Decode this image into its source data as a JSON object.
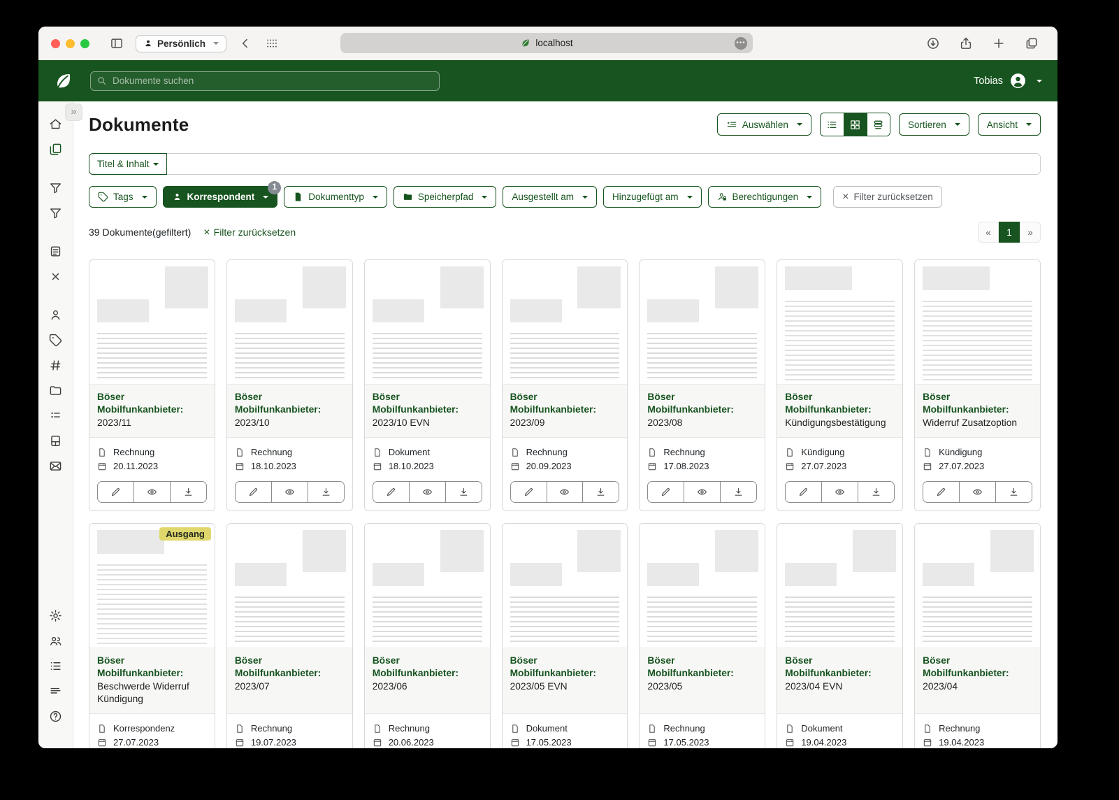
{
  "browser": {
    "profile_label": "Persönlich",
    "url_host": "localhost"
  },
  "app_header": {
    "search_placeholder": "Dokumente suchen",
    "user_name": "Tobias"
  },
  "sidebar_icons": [
    "home",
    "documents",
    "filter",
    "filter-alt",
    "notes",
    "close",
    "correspondents",
    "tags",
    "hash",
    "storage-paths",
    "custom-fields",
    "document-types",
    "mail",
    "settings",
    "users-groups",
    "tasks",
    "logs",
    "help"
  ],
  "page": {
    "title": "Dokumente",
    "select_label": "Auswählen",
    "sort_label": "Sortieren",
    "view_label": "Ansicht"
  },
  "search_bar": {
    "field_label": "Titel & Inhalt",
    "value": ""
  },
  "filters": {
    "tags_label": "Tags",
    "correspondent_label": "Korrespondent",
    "correspondent_count": "1",
    "document_type_label": "Dokumenttyp",
    "storage_path_label": "Speicherpfad",
    "created_label": "Ausgestellt am",
    "added_label": "Hinzugefügt am",
    "permissions_label": "Berechtigungen",
    "reset_label": "Filter zurücksetzen"
  },
  "results": {
    "count_text": "39 Dokumente(gefiltert)",
    "reset_label": "Filter zurücksetzen",
    "page_number": "1"
  },
  "documents": {
    "cards": [
      {
        "title_prefix": "Böser Mobilfunkanbieter:",
        "title_suffix": "2023/11",
        "doc_type": "Rechnung",
        "date": "20.11.2023",
        "thumb": "invoice"
      },
      {
        "title_prefix": "Böser Mobilfunkanbieter:",
        "title_suffix": "2023/10",
        "doc_type": "Rechnung",
        "date": "18.10.2023",
        "thumb": "invoice"
      },
      {
        "title_prefix": "Böser Mobilfunkanbieter:",
        "title_suffix": "2023/10 EVN",
        "doc_type": "Dokument",
        "date": "18.10.2023",
        "thumb": "invoice"
      },
      {
        "title_prefix": "Böser Mobilfunkanbieter:",
        "title_suffix": "2023/09",
        "doc_type": "Rechnung",
        "date": "20.09.2023",
        "thumb": "invoice"
      },
      {
        "title_prefix": "Böser Mobilfunkanbieter:",
        "title_suffix": "2023/08",
        "doc_type": "Rechnung",
        "date": "17.08.2023",
        "thumb": "invoice"
      },
      {
        "title_prefix": "Böser Mobilfunkanbieter:",
        "title_suffix": "Kündigungsbestätigung",
        "doc_type": "Kündigung",
        "date": "27.07.2023",
        "thumb": "letter"
      },
      {
        "title_prefix": "Böser Mobilfunkanbieter:",
        "title_suffix": "Widerruf Zusatzoption",
        "doc_type": "Kündigung",
        "date": "27.07.2023",
        "thumb": "letter"
      },
      {
        "title_prefix": "Böser Mobilfunkanbieter:",
        "title_suffix": "Beschwerde Widerruf Kündigung",
        "doc_type": "Korrespondenz",
        "date": "27.07.2023",
        "thumb": "letter",
        "badge": "Ausgang"
      },
      {
        "title_prefix": "Böser Mobilfunkanbieter:",
        "title_suffix": "2023/07",
        "doc_type": "Rechnung",
        "date": "19.07.2023",
        "thumb": "invoice"
      },
      {
        "title_prefix": "Böser Mobilfunkanbieter:",
        "title_suffix": "2023/06",
        "doc_type": "Rechnung",
        "date": "20.06.2023",
        "thumb": "invoice"
      },
      {
        "title_prefix": "Böser Mobilfunkanbieter:",
        "title_suffix": "2023/05 EVN",
        "doc_type": "Dokument",
        "date": "17.05.2023",
        "thumb": "invoice"
      },
      {
        "title_prefix": "Böser Mobilfunkanbieter:",
        "title_suffix": "2023/05",
        "doc_type": "Rechnung",
        "date": "17.05.2023",
        "thumb": "invoice"
      },
      {
        "title_prefix": "Böser Mobilfunkanbieter:",
        "title_suffix": "2023/04 EVN",
        "doc_type": "Dokument",
        "date": "19.04.2023",
        "thumb": "invoice"
      },
      {
        "title_prefix": "Böser Mobilfunkanbieter:",
        "title_suffix": "2023/04",
        "doc_type": "Rechnung",
        "date": "19.04.2023",
        "thumb": "invoice"
      }
    ]
  }
}
